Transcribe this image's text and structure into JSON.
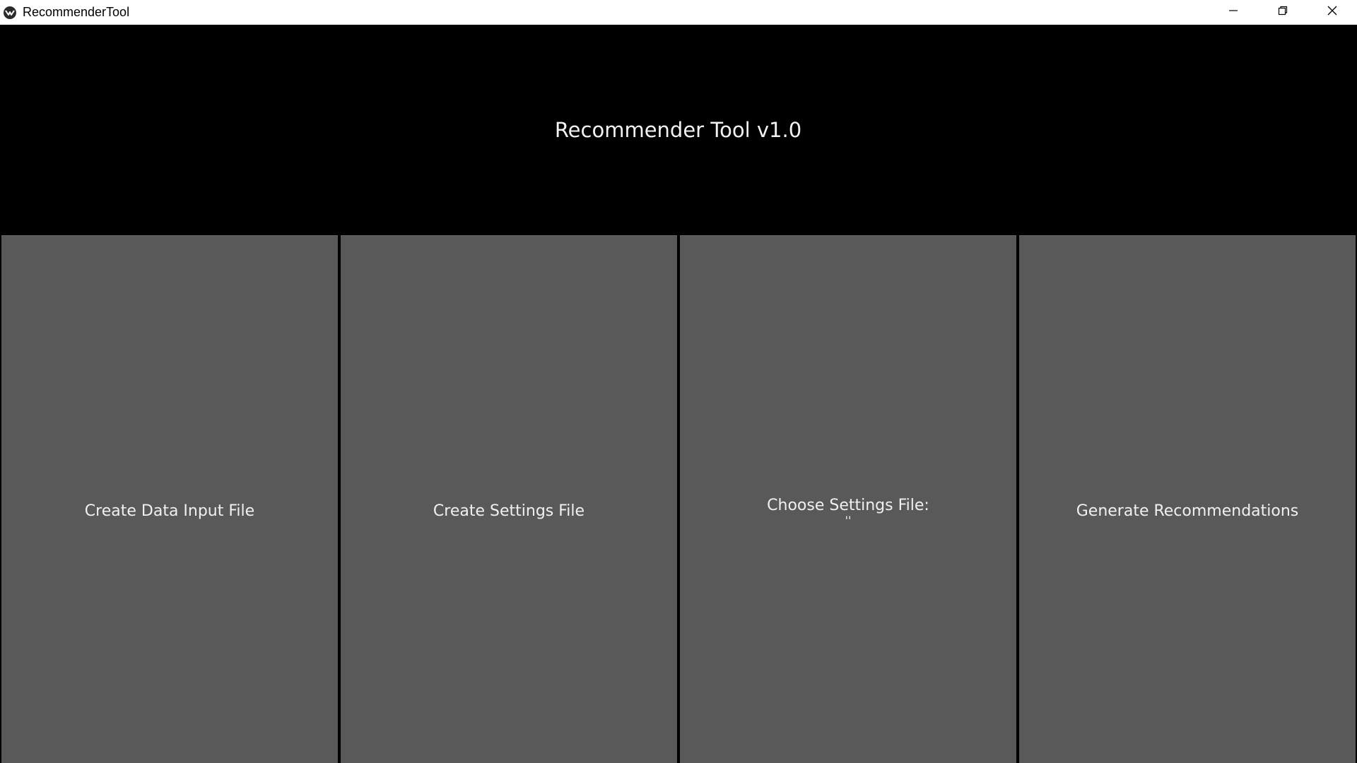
{
  "window": {
    "title": "RecommenderTool",
    "icon": "kivy-app-icon",
    "controls": [
      "minimize-icon",
      "restore-icon",
      "close-icon"
    ]
  },
  "header": {
    "title": "Recommender Tool v1.0"
  },
  "buttons": [
    {
      "label": "Create Data Input File"
    },
    {
      "label": "Create Settings File"
    },
    {
      "label": "Choose Settings File:",
      "sublabel": "''"
    },
    {
      "label": "Generate Recommendations"
    }
  ],
  "colors": {
    "background": "#000000",
    "button_bg": "#595959",
    "text": "#f0f0f0",
    "titlebar_bg": "#ffffff"
  }
}
